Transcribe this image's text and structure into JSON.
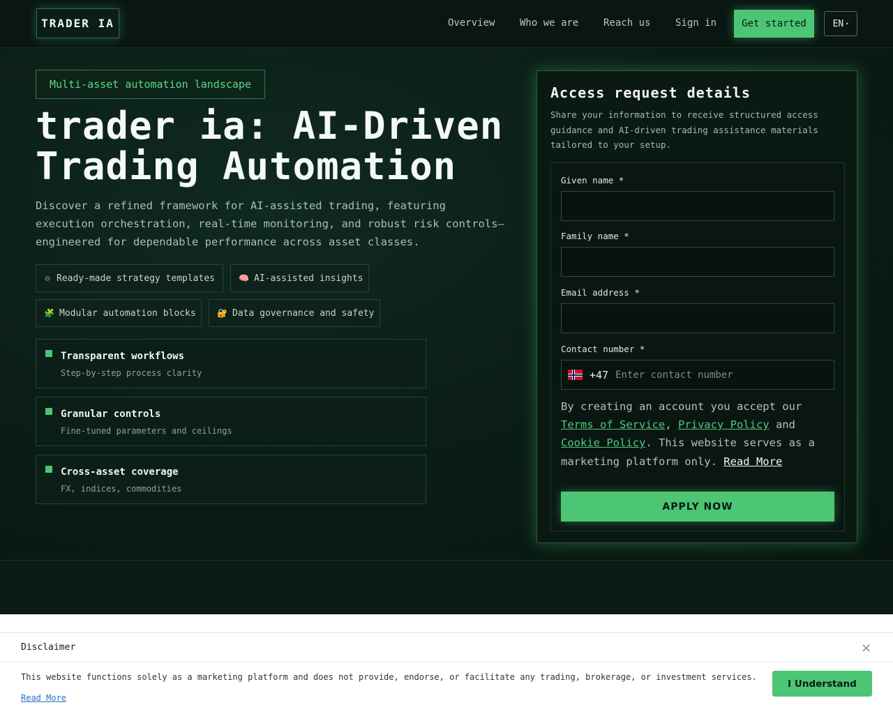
{
  "header": {
    "logo": "TRADER IA",
    "nav": [
      "Overview",
      "Who we are",
      "Reach us",
      "Sign in"
    ],
    "cta": "Get started",
    "lang": "EN",
    "lang_caret": "▾"
  },
  "hero": {
    "chip": "Multi-asset automation landscape",
    "title_line1": "trader ia: AI-Driven",
    "title_line2": "Trading Automation",
    "description": "Discover a refined framework for AI-assisted trading, featuring execution orchestration, real-time monitoring, and robust risk controls—engineered for dependable performance across asset classes.",
    "tags": [
      {
        "icon": "⚙",
        "label": "Ready-made strategy templates"
      },
      {
        "icon": "🧠",
        "label": "AI-assisted insights"
      },
      {
        "icon": "🧩",
        "label": "Modular automation blocks"
      },
      {
        "icon": "🔐",
        "label": "Data governance and safety"
      }
    ],
    "features": [
      {
        "title": "Transparent workflows",
        "subtitle": "Step-by-step process clarity"
      },
      {
        "title": "Granular controls",
        "subtitle": "Fine-tuned parameters and ceilings"
      },
      {
        "title": "Cross-asset coverage",
        "subtitle": "FX, indices, commodities"
      }
    ]
  },
  "form": {
    "title": "Access request details",
    "description": "Share your information to receive structured access guidance and AI-driven trading assistance materials tailored to your setup.",
    "given_name_label": "Given name *",
    "given_name_value": "",
    "family_name_label": "Family name *",
    "family_name_value": "",
    "email_label": "Email address *",
    "email_value": "",
    "phone_label": "Contact number *",
    "dial_code": "+47",
    "phone_placeholder": "Enter contact number",
    "consent_prefix": "By creating an account you accept our ",
    "terms": "Terms of Service",
    "comma": ", ",
    "privacy": "Privacy Policy",
    "and": " and ",
    "cookie": "Cookie Policy",
    "consent_suffix": ". This website serves as a marketing platform only. ",
    "read_more": "Read More",
    "submit": "APPLY NOW"
  },
  "disclaimer": {
    "title": "Disclaimer",
    "close": "×",
    "text": "This website functions solely as a marketing platform and does not provide, endorse, or facilitate any trading, brokerage, or investment services.",
    "read_more": "Read More",
    "button": "I Understand"
  },
  "colors": {
    "accent": "#4cc575",
    "background": "#071511",
    "link": "#2a6fc9"
  }
}
